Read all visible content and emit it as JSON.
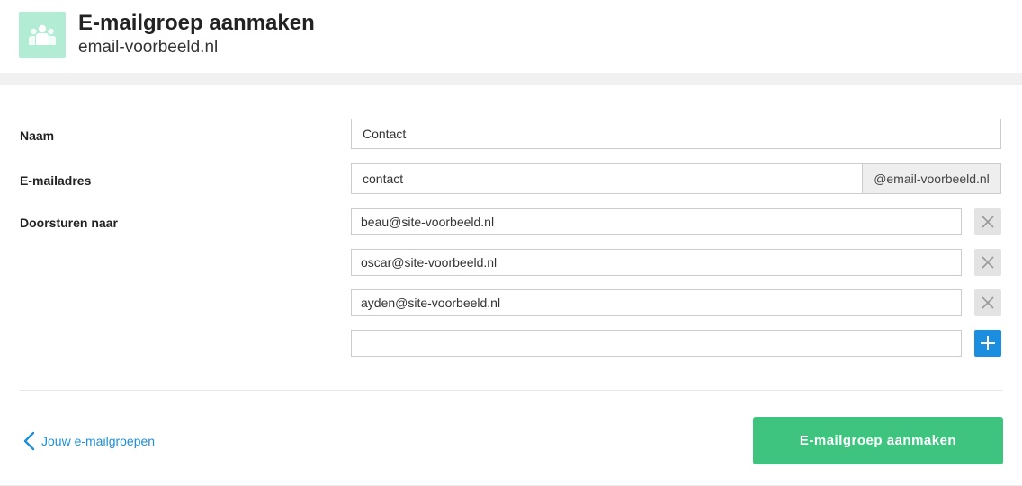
{
  "header": {
    "title": "E-mailgroep aanmaken",
    "subtitle": "email-voorbeeld.nl",
    "icon": "group-users-icon"
  },
  "form": {
    "name": {
      "label": "Naam",
      "value": "Contact"
    },
    "email": {
      "label": "E-mailadres",
      "value": "contact",
      "domain_suffix": "@email-voorbeeld.nl"
    },
    "forward": {
      "label": "Doorsturen naar",
      "addresses": [
        "beau@site-voorbeeld.nl",
        "oscar@site-voorbeeld.nl",
        "ayden@site-voorbeeld.nl"
      ],
      "new_value": ""
    }
  },
  "footer": {
    "back_label": "Jouw e-mailgroepen",
    "submit_label": "E-mailgroep aanmaken"
  },
  "colors": {
    "accent_green": "#3ec47f",
    "link_blue": "#1e8fd6",
    "add_button_blue": "#1c8ee0",
    "logo_bg": "#b3ecd4"
  }
}
